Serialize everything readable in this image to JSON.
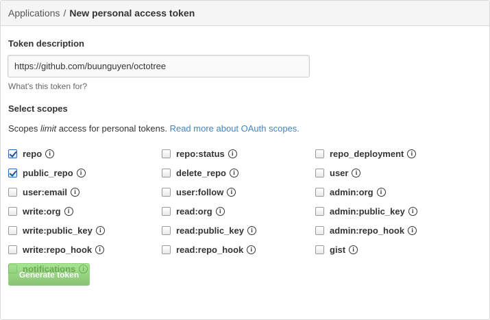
{
  "header": {
    "breadcrumb_parent": "Applications",
    "separator": "/",
    "title": "New personal access token"
  },
  "form": {
    "token_description_label": "Token description",
    "token_description_value": "https://github.com/buunguyen/octotree",
    "token_note": "What's this token for?",
    "scopes_label": "Select scopes",
    "scopes_desc_prefix": "Scopes ",
    "scopes_desc_em": "limit",
    "scopes_desc_suffix": " access for personal tokens. ",
    "scopes_link": "Read more about OAuth scopes.",
    "info_glyph": "i",
    "generate_button": "Generate token"
  },
  "scopes": [
    {
      "name": "repo",
      "checked": true
    },
    {
      "name": "repo:status",
      "checked": false
    },
    {
      "name": "repo_deployment",
      "checked": false
    },
    {
      "name": "public_repo",
      "checked": true
    },
    {
      "name": "delete_repo",
      "checked": false
    },
    {
      "name": "user",
      "checked": false
    },
    {
      "name": "user:email",
      "checked": false
    },
    {
      "name": "user:follow",
      "checked": false
    },
    {
      "name": "admin:org",
      "checked": false
    },
    {
      "name": "write:org",
      "checked": false
    },
    {
      "name": "read:org",
      "checked": false
    },
    {
      "name": "admin:public_key",
      "checked": false
    },
    {
      "name": "write:public_key",
      "checked": false
    },
    {
      "name": "read:public_key",
      "checked": false
    },
    {
      "name": "admin:repo_hook",
      "checked": false
    },
    {
      "name": "write:repo_hook",
      "checked": false
    },
    {
      "name": "read:repo_hook",
      "checked": false
    },
    {
      "name": "gist",
      "checked": false
    },
    {
      "name": "notifications",
      "checked": false
    }
  ],
  "colors": {
    "link": "#4183c4",
    "button_green": "#60b044",
    "checkbox_checked": "#2a63b3"
  }
}
